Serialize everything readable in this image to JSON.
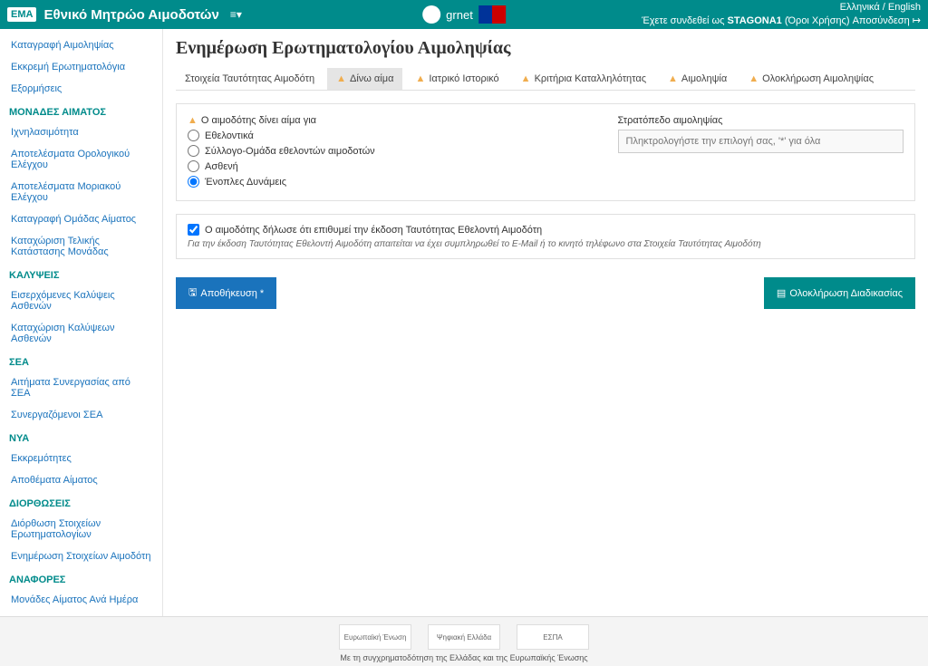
{
  "header": {
    "logo": "EMA",
    "title": "Εθνικό Μητρώο Αιμοδοτών",
    "lang": "Ελληνικά / English",
    "session_prefix": "Έχετε συνδεθεί ως",
    "session_user": "STAGONA1",
    "session_role": "(Όροι Χρήσης)",
    "logout": "Αποσύνδεση",
    "center_brand": "grnet"
  },
  "sidebar": {
    "groups": [
      {
        "items": [
          {
            "label": "Καταγραφή Αιμοληψίας"
          },
          {
            "label": "Εκκρεμή Ερωτηματολόγια"
          },
          {
            "label": "Εξορμήσεις"
          }
        ]
      },
      {
        "header": "ΜΟΝΑΔΕΣ ΑΙΜΑΤΟΣ",
        "items": [
          {
            "label": "Ιχνηλασιμότητα"
          },
          {
            "label": "Αποτελέσματα Ορολογικού Ελέγχου"
          },
          {
            "label": "Αποτελέσματα Μοριακού Ελέγχου"
          },
          {
            "label": "Καταγραφή Ομάδας Αίματος"
          },
          {
            "label": "Καταχώριση Τελικής Κατάστασης Μονάδας"
          }
        ]
      },
      {
        "header": "ΚΑΛΥΨΕΙΣ",
        "items": [
          {
            "label": "Εισερχόμενες Καλύψεις Ασθενών"
          },
          {
            "label": "Καταχώριση Καλύψεων Ασθενών"
          }
        ]
      },
      {
        "header": "ΣΕΑ",
        "items": [
          {
            "label": "Αιτήματα Συνεργασίας από ΣΕΑ"
          },
          {
            "label": "Συνεργαζόμενοι ΣΕΑ"
          }
        ]
      },
      {
        "header": "ΝΥΑ",
        "items": [
          {
            "label": "Εκκρεμότητες"
          },
          {
            "label": "Αποθέματα Αίματος"
          }
        ]
      },
      {
        "header": "ΔΙΟΡΘΩΣΕΙΣ",
        "items": [
          {
            "label": "Διόρθωση Στοιχείων Ερωτηματολογίων"
          },
          {
            "label": "Ενημέρωση Στοιχείων Αιμοδότη"
          }
        ]
      },
      {
        "header": "ΑΝΑΦΟΡΕΣ",
        "items": [
          {
            "label": "Μονάδες Αίματος Ανά Ημέρα"
          }
        ]
      }
    ]
  },
  "page": {
    "title": "Ενημέρωση Ερωτηματολογίου Αιμοληψίας"
  },
  "tabs": [
    {
      "label": "Στοιχεία Ταυτότητας Αιμοδότη",
      "warn": false
    },
    {
      "label": "Δίνω αίμα",
      "warn": true,
      "active": true
    },
    {
      "label": "Ιατρικό Ιστορικό",
      "warn": true
    },
    {
      "label": "Κριτήρια Καταλληλότητας",
      "warn": true
    },
    {
      "label": "Αιμοληψία",
      "warn": true
    },
    {
      "label": "Ολοκλήρωση Αιμοληψίας",
      "warn": true
    }
  ],
  "question": {
    "label": "Ο αιμοδότης δίνει αίμα για",
    "options": [
      "Εθελοντικά",
      "Σύλλογο-Ομάδα εθελοντών αιμοδοτών",
      "Ασθενή",
      "Ένοπλες Δυνάμεις"
    ],
    "selected": 3
  },
  "camp": {
    "label": "Στρατόπεδο αιμοληψίας",
    "placeholder": "Πληκτρολογήστε την επιλογή σας, '*' για όλα"
  },
  "consent": {
    "label": "Ο αιμοδότης δήλωσε ότι επιθυμεί την έκδοση Ταυτότητας Εθελοντή Αιμοδότη",
    "hint": "Για την έκδοση Ταυτότητας Εθελοντή Αιμοδότη απαιτείται να έχει συμπληρωθεί το E-Mail ή το κινητό τηλέφωνο στα Στοιχεία Ταυτότητας Αιμοδότη",
    "checked": true
  },
  "buttons": {
    "save": "Αποθήκευση *",
    "complete": "Ολοκλήρωση Διαδικασίας"
  },
  "footer": {
    "logos": [
      "Ευρωπαϊκή Ένωση",
      "Ψηφιακή Ελλάδα",
      "ΕΣΠΑ"
    ],
    "text": "Με τη συγχρηματοδότηση της Ελλάδας και της Ευρωπαϊκής Ένωσης"
  }
}
